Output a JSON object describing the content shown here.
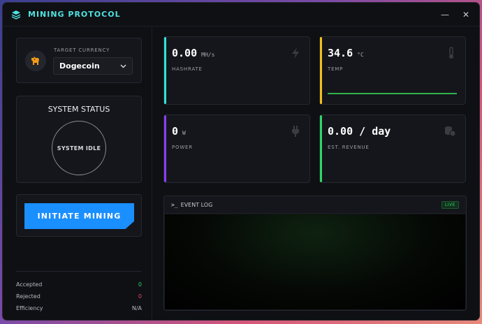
{
  "app": {
    "title": "MINING PROTOCOL"
  },
  "window_controls": {
    "minimize": "—",
    "close": "✕"
  },
  "currency": {
    "label": "TARGET CURRENCY",
    "selected": "Dogecoin",
    "icon": "dog-icon"
  },
  "status": {
    "title": "SYSTEM STATUS",
    "state": "SYSTEM IDLE"
  },
  "action": {
    "button_label": "INITIATE MINING"
  },
  "stats": [
    {
      "label": "Accepted",
      "value": "0"
    },
    {
      "label": "Rejected",
      "value": "0"
    },
    {
      "label": "Efficiency",
      "value": "N/A"
    }
  ],
  "metrics": {
    "hashrate": {
      "value": "0.00",
      "unit": "MH/s",
      "label": "HASHRATE",
      "accent": "#2ee6d6",
      "icon": "bolt-icon"
    },
    "temp": {
      "value": "34.6",
      "unit": "°C",
      "label": "TEMP",
      "accent": "#f2c21b",
      "icon": "thermometer-icon"
    },
    "power": {
      "value": "0",
      "unit": "W",
      "label": "POWER",
      "accent": "#8a3dff",
      "icon": "plug-icon"
    },
    "revenue": {
      "value": "0.00 / day",
      "unit": "",
      "label": "EST. REVENUE",
      "accent": "#2fd56a",
      "icon": "coins-icon"
    }
  },
  "event_log": {
    "prompt": ">_",
    "title": "EVENT LOG",
    "badge": "LIVE"
  },
  "colors": {
    "accent": "#4fe3e0",
    "button": "#1a8fff",
    "success": "#2fd56a",
    "danger": "#e0455a"
  }
}
